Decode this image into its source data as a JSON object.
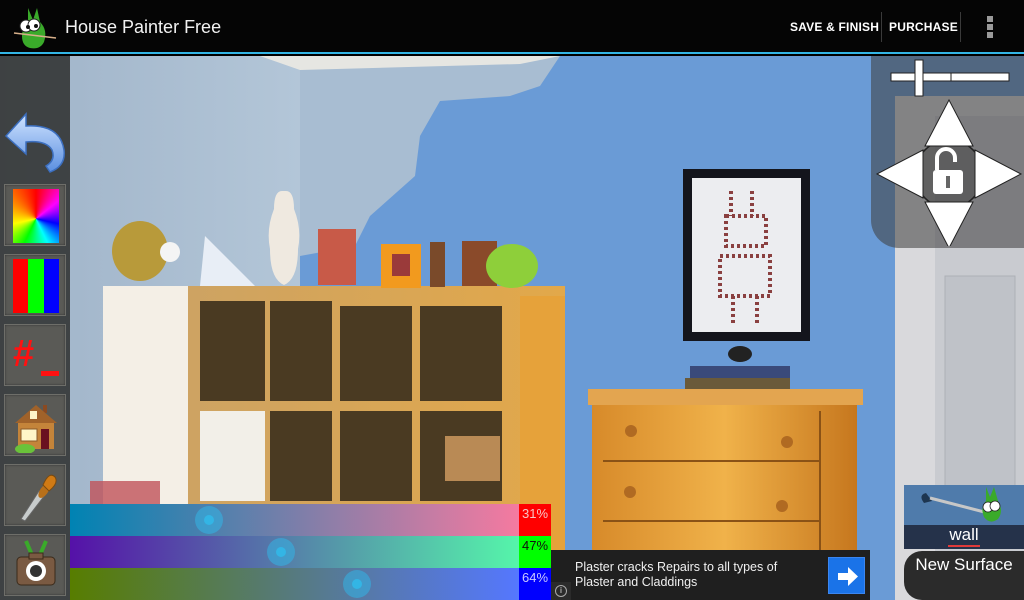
{
  "app": {
    "title": "House Painter Free",
    "icon": "grasshopper-painter-logo"
  },
  "actionbar": {
    "save_label": "SAVE & FINISH",
    "purchase_label": "PURCHASE",
    "overflow_icon": "overflow-menu-icon"
  },
  "tools": [
    {
      "name": "undo",
      "icon": "undo-arrow-icon"
    },
    {
      "name": "color-wheel",
      "icon": "color-wheel-icon"
    },
    {
      "name": "rgb-sliders",
      "icon": "rgb-bars-icon"
    },
    {
      "name": "hex-code",
      "icon": "hex-code-icon",
      "glyph": "#"
    },
    {
      "name": "house-colors",
      "icon": "house-icon"
    },
    {
      "name": "eyedropper",
      "icon": "eyedropper-icon"
    },
    {
      "name": "camera",
      "icon": "camera-icon"
    }
  ],
  "navpad": {
    "zoom_in_icon": "plus-icon",
    "zoom_out_icon": "minus-icon",
    "lock_icon": "unlock-icon",
    "arrows": [
      "up",
      "left",
      "right",
      "down"
    ]
  },
  "sliders": [
    {
      "channel": "red",
      "value_pct": 31,
      "label": "31%",
      "from": "#0083b3",
      "to": "#f57aa0",
      "badge": "#ff0000",
      "text_color": "#f7c6c6"
    },
    {
      "channel": "green",
      "value_pct": 47,
      "label": "47%",
      "from": "#5511a8",
      "to": "#55f5aa",
      "badge": "#00ff00",
      "text_color": "#111111"
    },
    {
      "channel": "blue",
      "value_pct": 64,
      "label": "64%",
      "from": "#577d00",
      "to": "#5577ff",
      "badge": "#0000ff",
      "text_color": "#c8c8ff"
    }
  ],
  "ad": {
    "text": "Plaster cracks Repairs to all types of Plaster and Claddings",
    "info_glyph": "i",
    "arrow_icon": "arrow-right-icon"
  },
  "surface": {
    "current": "wall",
    "new_label": "New Surface"
  },
  "colors": {
    "accent": "#33b5e5",
    "painted_wall": "#6f9fd8",
    "original_wall": "#a9bdd3"
  }
}
